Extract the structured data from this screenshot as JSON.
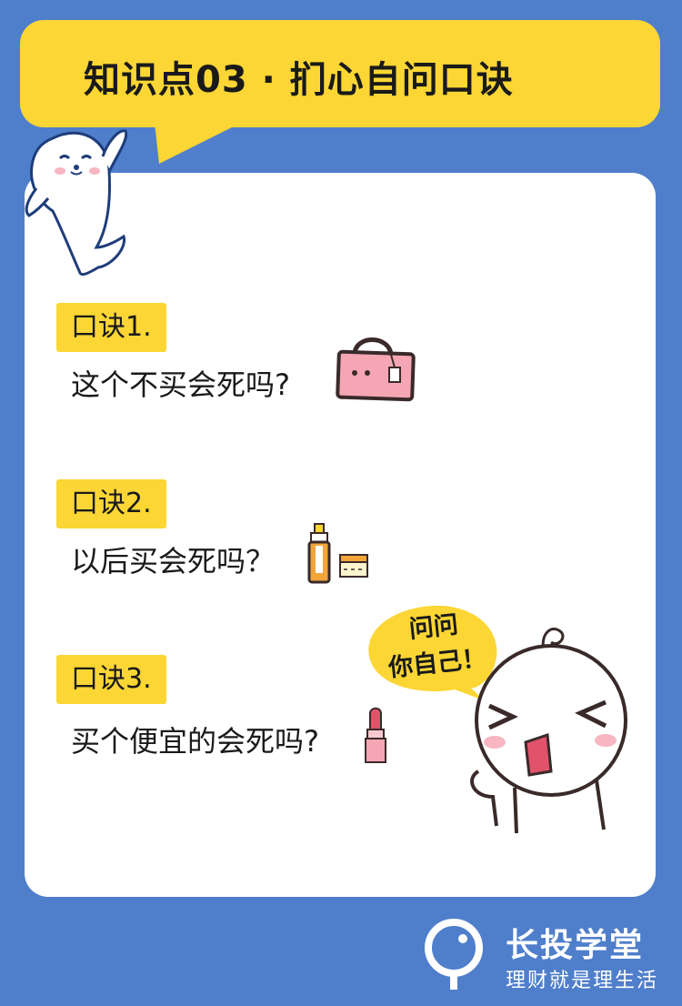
{
  "header": {
    "title": "知识点03 · 扪心自问口诀"
  },
  "tips": [
    {
      "tag": "口诀1.",
      "question": "这个不买会死吗?"
    },
    {
      "tag": "口诀2.",
      "question": "以后买会死吗？"
    },
    {
      "tag": "口诀3.",
      "question": "买个便宜的会死吗?"
    }
  ],
  "speech": {
    "line1": "问问",
    "line2": "你自己！"
  },
  "brand": {
    "name": "长投学堂",
    "slogan": "理财就是理生活"
  },
  "colors": {
    "background": "#4f7ecb",
    "accent": "#fbd634",
    "card": "#ffffff"
  }
}
